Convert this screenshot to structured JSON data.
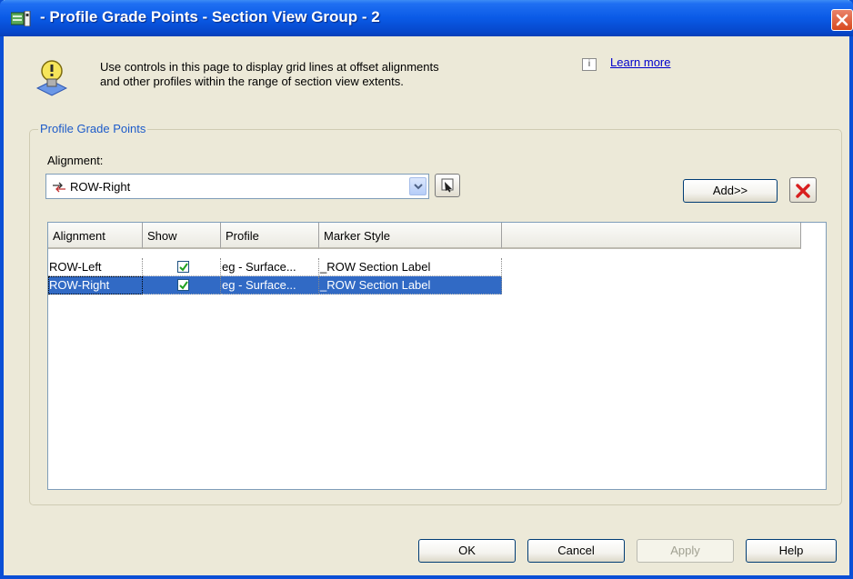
{
  "window": {
    "title": "- Profile Grade Points - Section View Group - 2"
  },
  "info": {
    "line1": "Use controls in this page to display grid lines at offset alignments",
    "line2": "and other profiles within the range of section view extents.",
    "learn_more": "Learn more"
  },
  "group": {
    "legend": "Profile Grade Points",
    "alignment_label": "Alignment:",
    "alignment_value": "ROW-Right",
    "add_label": "Add>>"
  },
  "grid": {
    "columns": [
      "Alignment",
      "Show",
      "Profile",
      "Marker Style"
    ],
    "rows": [
      {
        "alignment": "ROW-Left",
        "show": true,
        "profile": "eg - Surface...",
        "marker_style": "_ROW Section Label",
        "selected": false
      },
      {
        "alignment": "ROW-Right",
        "show": true,
        "profile": "eg - Surface...",
        "marker_style": "_ROW Section Label",
        "selected": true
      }
    ]
  },
  "footer": {
    "ok": "OK",
    "cancel": "Cancel",
    "apply": "Apply",
    "help": "Help"
  },
  "colors": {
    "title_bar": "#0a5ae6",
    "selection": "#316ac5",
    "link": "#0000cc",
    "legend": "#1d5bc9"
  },
  "icons": {
    "title": "dialog-app-icon",
    "info": "lightbulb-info-icon",
    "learn_more": "info-box-icon",
    "combo": "alignment-icon",
    "pick": "pick-from-drawing-icon",
    "delete": "red-x-delete-icon",
    "close": "close-icon"
  }
}
